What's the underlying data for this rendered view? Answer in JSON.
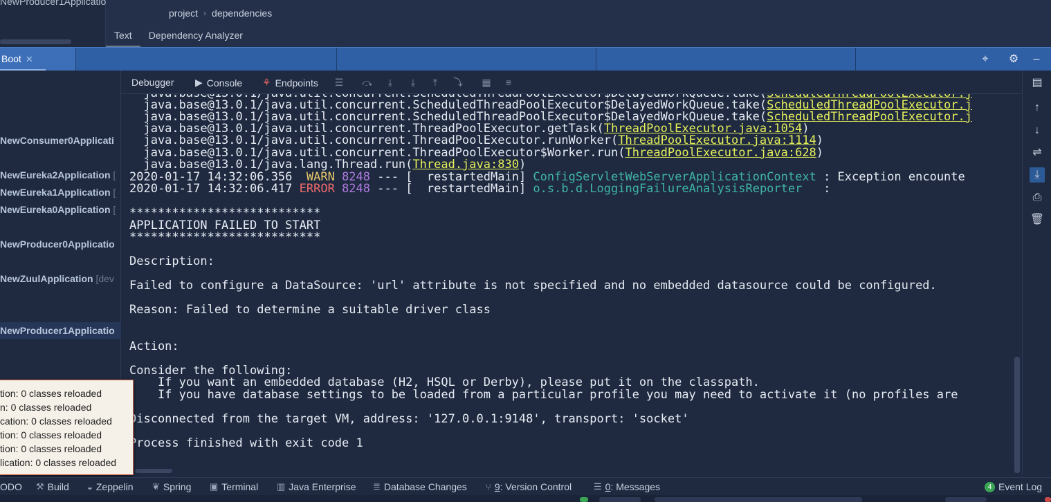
{
  "top": {
    "project_name": "NewProducer1Applicatio",
    "breadcrumb": [
      "project",
      "dependencies"
    ],
    "editor_tabs": [
      "Text",
      "Dependency Analyzer"
    ]
  },
  "run_bar": {
    "tab_label": "Boot",
    "close_glyph": "✕"
  },
  "services": [
    {
      "name": "NewConsumer0Applicati",
      "tag": ""
    },
    {
      "name": "NewEureka2Application",
      "tag": " ["
    },
    {
      "name": "NewEureka1Application",
      "tag": " ["
    },
    {
      "name": "NewEureka0Application",
      "tag": " ["
    },
    {
      "name": "NewProducer0Applicatio",
      "tag": ""
    },
    {
      "name": "NewZuulApplication",
      "tag": " [dev"
    },
    {
      "name": "NewProducer1Applicatio",
      "tag": ""
    }
  ],
  "debug_toolbar": {
    "tabs": [
      "Debugger",
      "Console",
      "Endpoints"
    ]
  },
  "console": {
    "stack": [
      {
        "pre": "  java.base@13.0.1/java.util.concurrent.ScheduledThreadPoolExecutor$DelayedWorkQueue.take(",
        "link": "ScheduledThreadPoolExecutor.j",
        "post": ""
      },
      {
        "pre": "  java.base@13.0.1/java.util.concurrent.ScheduledThreadPoolExecutor$DelayedWorkQueue.take(",
        "link": "ScheduledThreadPoolExecutor.j",
        "post": ""
      },
      {
        "pre": "  java.base@13.0.1/java.util.concurrent.ThreadPoolExecutor.getTask(",
        "link": "ThreadPoolExecutor.java:1054",
        "post": ")"
      },
      {
        "pre": "  java.base@13.0.1/java.util.concurrent.ThreadPoolExecutor.runWorker(",
        "link": "ThreadPoolExecutor.java:1114",
        "post": ")"
      },
      {
        "pre": "  java.base@13.0.1/java.util.concurrent.ThreadPoolExecutor$Worker.run(",
        "link": "ThreadPoolExecutor.java:628",
        "post": ")"
      },
      {
        "pre": "  java.base@13.0.1/java.lang.Thread.run(",
        "link": "Thread.java:830",
        "post": ")"
      }
    ],
    "log1": {
      "ts": "2020-01-17 14:32:06.356 ",
      "level": " WARN",
      "pid": " 8248",
      "mid": " --- [  restartedMain] ",
      "cls": "ConfigServletWebServerApplicationContext",
      "msg": " : Exception encounte"
    },
    "log2": {
      "ts": "2020-01-17 14:32:06.417 ",
      "level": "ERROR",
      "pid": " 8248",
      "mid": " --- [  restartedMain] ",
      "cls": "o.s.b.d.LoggingFailureAnalysisReporter",
      "msg": "   :"
    },
    "stars": "***************************",
    "failed": "APPLICATION FAILED TO START",
    "description_h": "Description:",
    "description": "Failed to configure a DataSource: 'url' attribute is not specified and no embedded datasource could be configured.",
    "reason": "Reason: Failed to determine a suitable driver class",
    "action_h": "Action:",
    "consider": "Consider the following:",
    "opt1": "    If you want an embedded database (H2, HSQL or Derby), please put it on the classpath.",
    "opt2": "    If you have database settings to be loaded from a particular profile you may need to activate it (no profiles are",
    "disconnected": "Disconnected from the target VM, address: '127.0.0.1:9148', transport: 'socket'",
    "finished": "Process finished with exit code 1"
  },
  "popup": [
    "tion: 0 classes reloaded",
    "n: 0 classes reloaded",
    "cation: 0 classes reloaded",
    "tion: 0 classes reloaded",
    "tion: 0 classes reloaded",
    "lication: 0 classes reloaded"
  ],
  "bottom_bar": {
    "todo": "ODO",
    "build": "Build",
    "zeppelin": "Zeppelin",
    "spring": "Spring",
    "terminal": "Terminal",
    "java_enterprise": "Java Enterprise",
    "db_changes": "Database Changes",
    "vcs_num": "9",
    "vcs": ": Version Control",
    "msg_num": "0",
    "messages": ": Messages",
    "event_count": "4",
    "event_log": "Event Log"
  },
  "colors": {
    "accent_bar": "#2f5fa5",
    "link": "#e6f05a",
    "error": "#f06a6a",
    "warn": "#e6c86a",
    "class": "#3fb4a8",
    "pid": "#b07ae0"
  }
}
